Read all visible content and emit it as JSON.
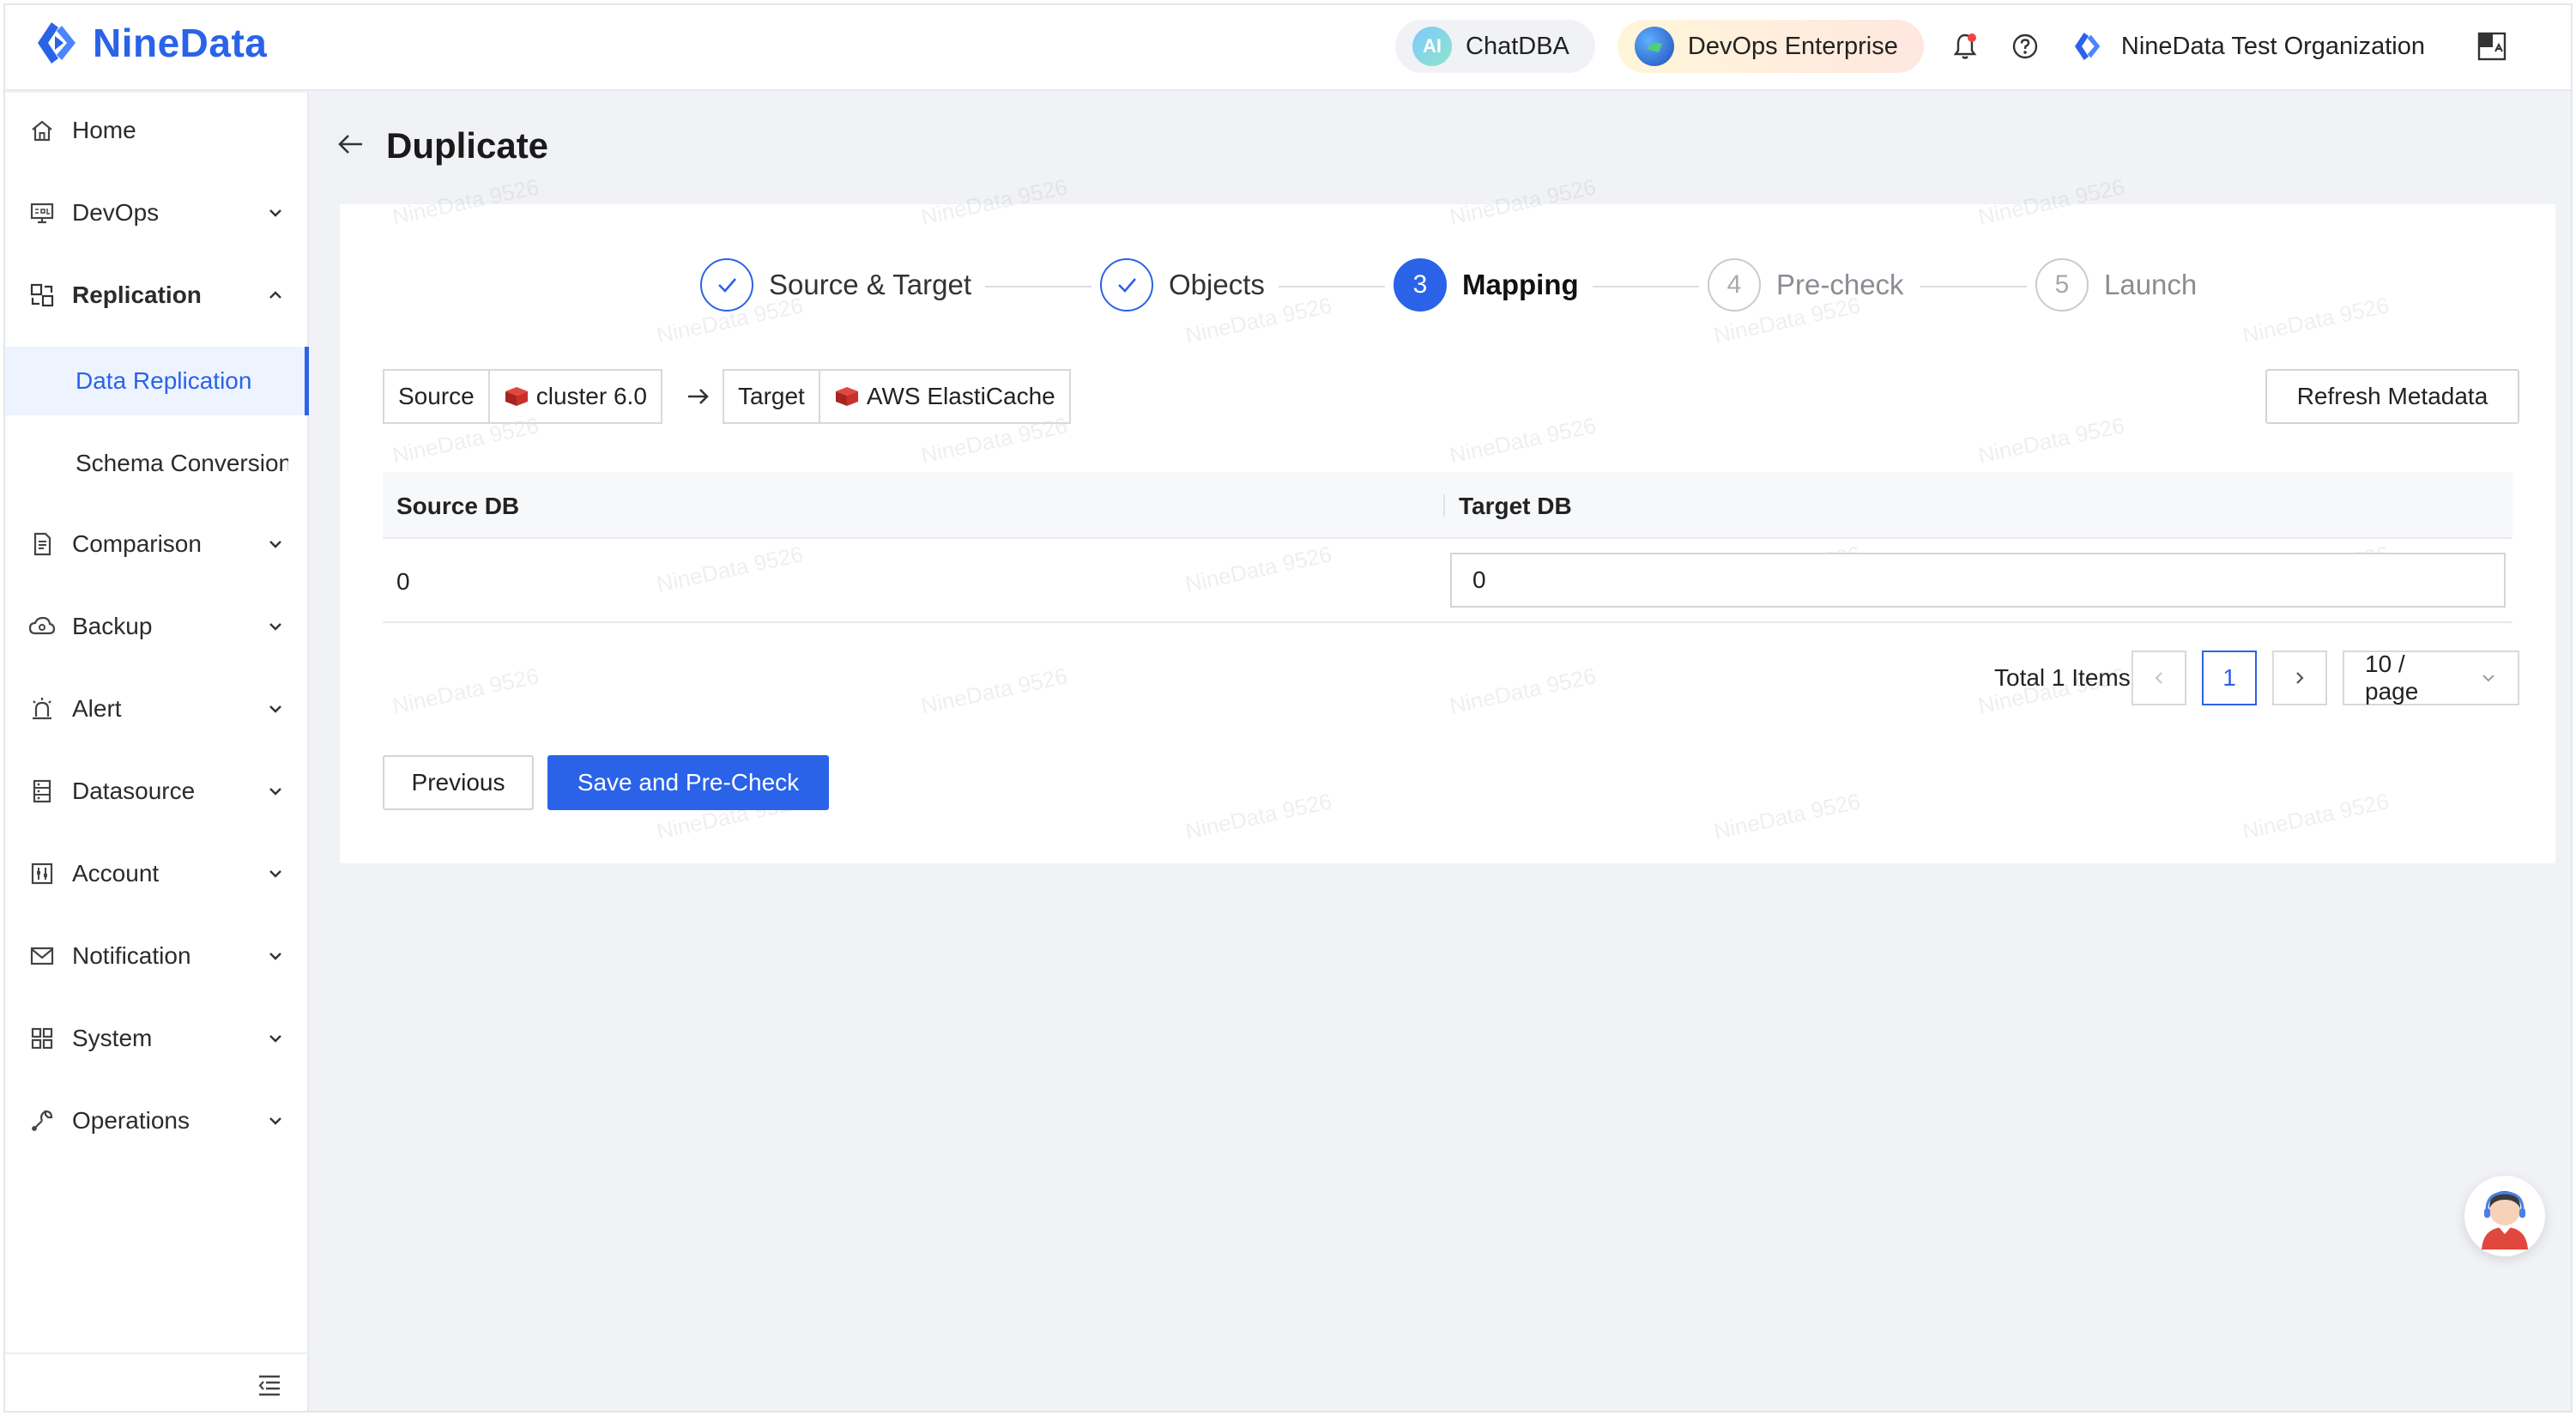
{
  "header": {
    "logo_text": "NineData",
    "chatdba_label": "ChatDBA",
    "chatdba_badge": "AI",
    "enterprise_label": "DevOps Enterprise",
    "org_name": "NineData Test Organization"
  },
  "sidebar": {
    "items": [
      {
        "label": "Home",
        "icon": "home-icon"
      },
      {
        "label": "DevOps",
        "icon": "sql-monitor-icon"
      },
      {
        "label": "Replication",
        "icon": "replication-icon"
      },
      {
        "label": "Comparison",
        "icon": "document-icon"
      },
      {
        "label": "Backup",
        "icon": "cloud-icon"
      },
      {
        "label": "Alert",
        "icon": "alarm-icon"
      },
      {
        "label": "Datasource",
        "icon": "database-icon"
      },
      {
        "label": "Account",
        "icon": "account-icon"
      },
      {
        "label": "Notification",
        "icon": "mail-icon"
      },
      {
        "label": "System",
        "icon": "grid-icon"
      },
      {
        "label": "Operations",
        "icon": "wrench-icon"
      }
    ],
    "sub_items": [
      {
        "label": "Data Replication",
        "active": true
      },
      {
        "label": "Schema Conversion",
        "active": false
      }
    ]
  },
  "page": {
    "title": "Duplicate"
  },
  "steps": [
    {
      "label": "Source & Target",
      "status": "done",
      "number": "1"
    },
    {
      "label": "Objects",
      "status": "done",
      "number": "2"
    },
    {
      "label": "Mapping",
      "status": "current",
      "number": "3"
    },
    {
      "label": "Pre-check",
      "status": "wait",
      "number": "4"
    },
    {
      "label": "Launch",
      "status": "wait",
      "number": "5"
    }
  ],
  "source_tag": {
    "key": "Source",
    "value": "cluster 6.0"
  },
  "target_tag": {
    "key": "Target",
    "value": "AWS ElastiCache"
  },
  "refresh_label": "Refresh Metadata",
  "table": {
    "columns": [
      "Source DB",
      "Target DB"
    ],
    "rows": [
      {
        "source": "0",
        "target": "0"
      }
    ]
  },
  "pagination": {
    "total_text": "Total 1 Items",
    "current_page": "1",
    "page_size": "10 / page"
  },
  "actions": {
    "previous_label": "Previous",
    "save_label": "Save and Pre-Check"
  },
  "watermark": "NineData 9526",
  "colors": {
    "accent": "#2a63e8",
    "redis_red": "#c8322b"
  }
}
